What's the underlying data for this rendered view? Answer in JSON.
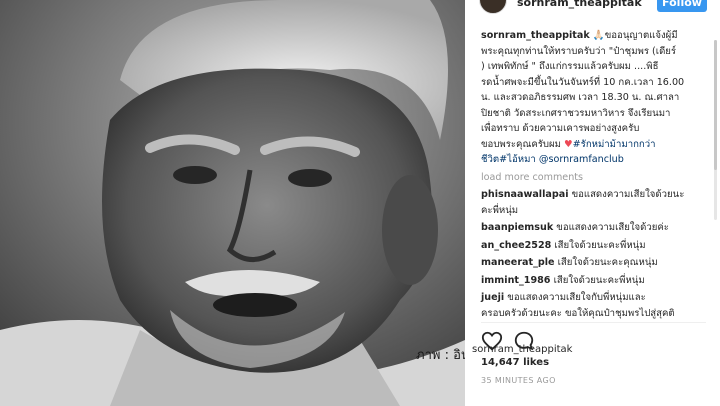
{
  "header": {
    "username": "sornram_theappitak",
    "follow_label": "Follow"
  },
  "photo_caption": "ภาพ : อินสตาแกรม",
  "post": {
    "author": "sornram_theappitak",
    "caption_lines": [
      "🙏🏻ขออนุญาตแจ้งผู้มี",
      "พระคุณทุกท่านให้ทราบครับว่า \"ป๋าชุมพร (เดียร์",
      ") เทพพิทักษ์ \" ถึงแก่กรรมแล้วครับผม ....พิธี",
      "รดน้ำศพจะมีขึ้นในวันจันทร์ที่ 10 กค.เวลา 16.00",
      "น. และสวดอภิธรรมศพ เวลา 18.30 น. ณ.ศาลา",
      "ปิยชาติ วัดสระเกศราชวรมหาวิหาร จึงเรียนมา",
      "เพื่อทราบ ด้วยความเคารพอย่างสูงครับ",
      "ขอบพระคุณครับผม"
    ],
    "hashtag_1": "#รักหม่าม้ามากกว่า",
    "hashtag_1b": "ชีวิต",
    "hashtag_2": "#ไอ้หมา",
    "mention": "@sornramfanclub",
    "load_more": "load more comments",
    "likes": "14,647 likes",
    "time": "35 MINUTES AGO",
    "owner_tag": "sornram_theappitak"
  },
  "comments": [
    {
      "user": "phisnaawallapai",
      "text": "ขอแสดงความเสียใจด้วยนะ",
      "text2": "คะพี่หนุ่ม"
    },
    {
      "user": "baanpiemsuk",
      "text": "ขอแสดงความเสียใจด้วยค่ะ",
      "text2": ""
    },
    {
      "user": "an_chee2528",
      "text": "เสียใจด้วยนะคะพี่หนุ่ม",
      "text2": ""
    },
    {
      "user": "maneerat_ple",
      "text": "เสียใจด้วยนะคะคุณหนุ่ม",
      "text2": ""
    },
    {
      "user": "immint_1986",
      "text": "เสียใจด้วยนะคะพี่หนุ่ม",
      "text2": ""
    },
    {
      "user": "jueji",
      "text": "ขอแสดงความเสียใจกับพี่หนุ่มและ",
      "text2": "ครอบครัวด้วยนะคะ ขอให้คุณป๋าชุมพรไปสู่สุคติ"
    }
  ],
  "colors": {
    "follow": "#3897f0",
    "link": "#003569",
    "heart": "#ed4956"
  }
}
